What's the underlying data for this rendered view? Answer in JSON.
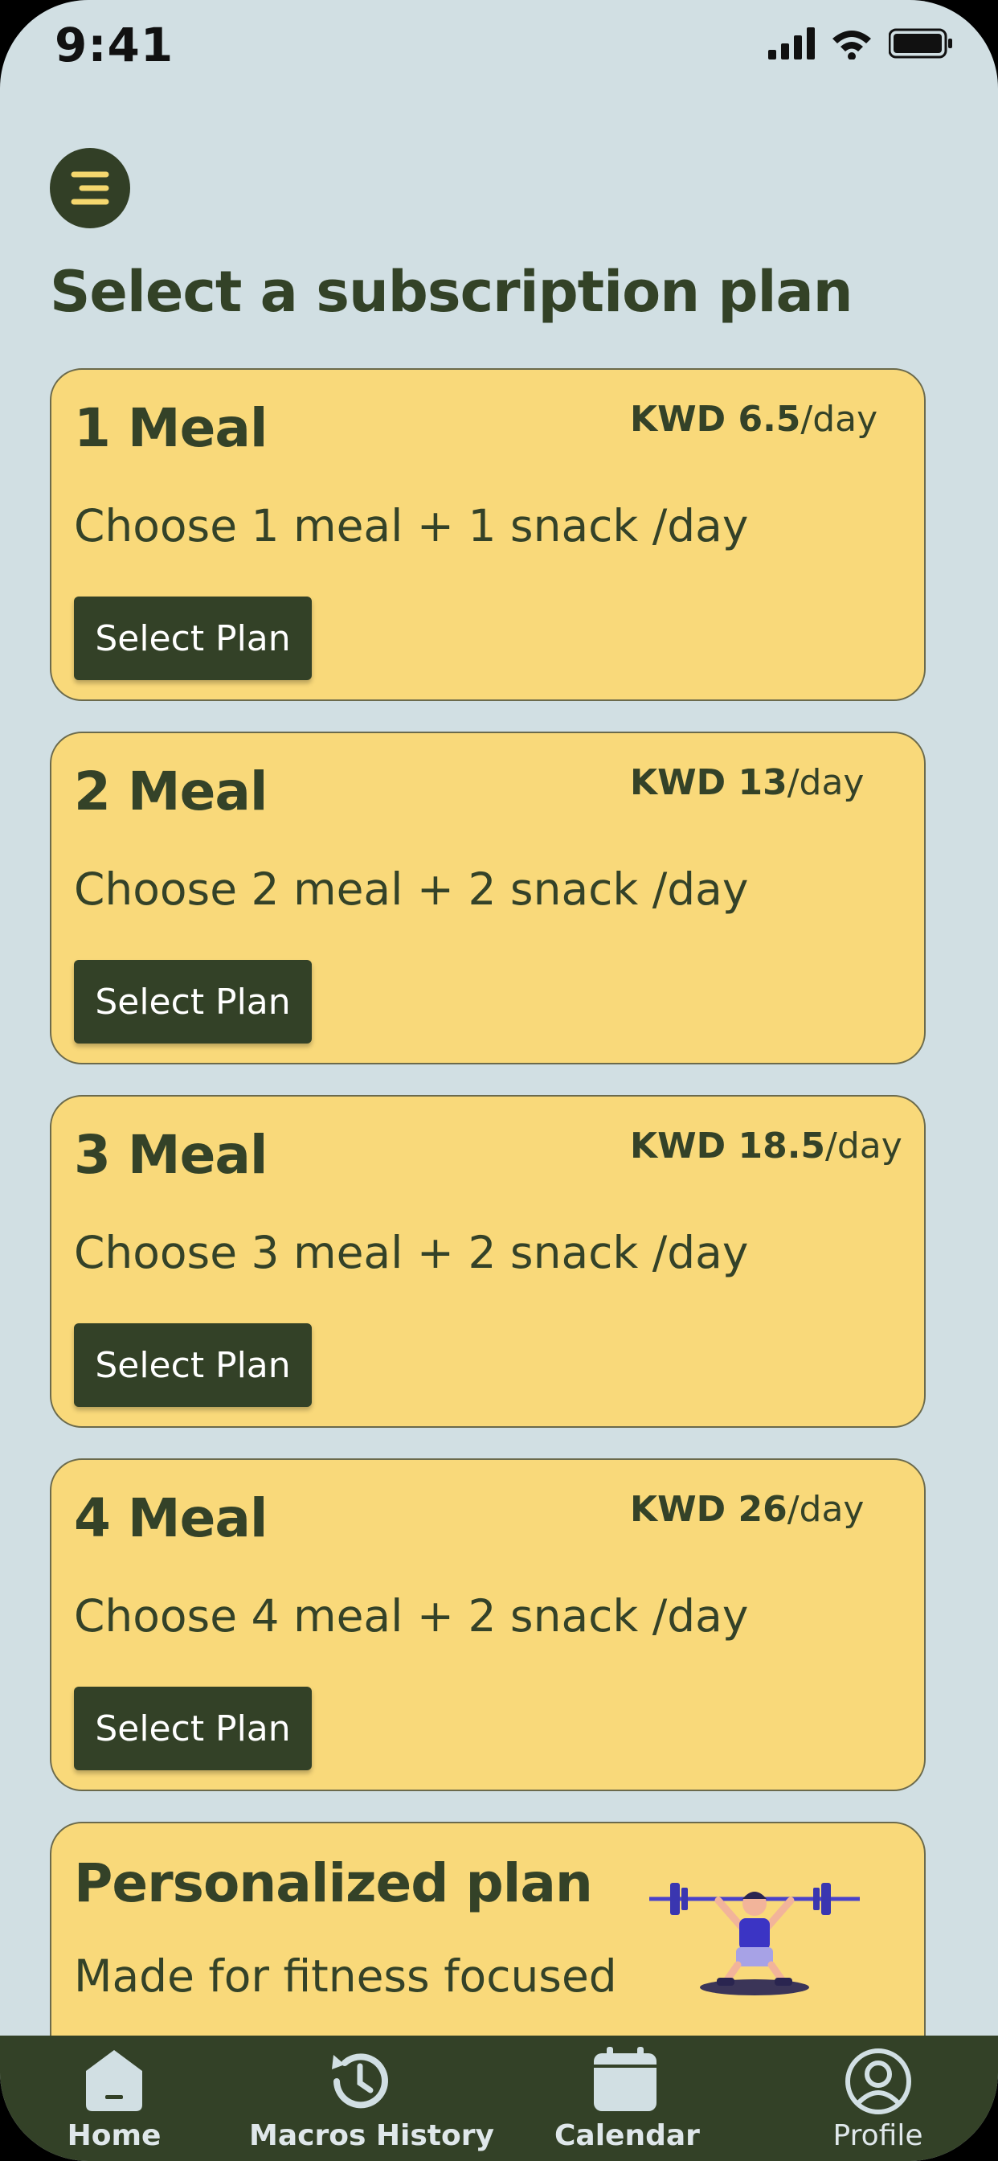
{
  "status_bar": {
    "time": "9:41"
  },
  "header": {
    "title": "Select a subscription plan"
  },
  "plans": [
    {
      "name": "1 Meal",
      "price": "KWD 6.5",
      "unit": "/day",
      "description": "Choose 1 meal + 1 snack /day",
      "button": "Select Plan"
    },
    {
      "name": "2 Meal",
      "price": "KWD 13",
      "unit": "/day",
      "description": "Choose 2 meal + 2 snack /day",
      "button": "Select Plan"
    },
    {
      "name": "3 Meal",
      "price": "KWD 18.5",
      "unit": "/day",
      "description": "Choose 3 meal + 2 snack /day",
      "button": "Select Plan"
    },
    {
      "name": "4 Meal",
      "price": "KWD 26",
      "unit": "/day",
      "description": "Choose 4 meal + 2 snack /day",
      "button": "Select Plan"
    }
  ],
  "personalized": {
    "name": "Personalized plan",
    "description": "Made for fitness focused"
  },
  "bottom_nav": [
    {
      "label": "Home",
      "icon": "home-icon"
    },
    {
      "label": "Macros History",
      "icon": "history-icon"
    },
    {
      "label": "Calendar",
      "icon": "calendar-icon"
    },
    {
      "label": "Profile",
      "icon": "profile-icon"
    }
  ],
  "colors": {
    "background": "#d1dfe3",
    "card": "#f9d97a",
    "dark_green": "#334127",
    "accent_yellow": "#f5d76e"
  }
}
